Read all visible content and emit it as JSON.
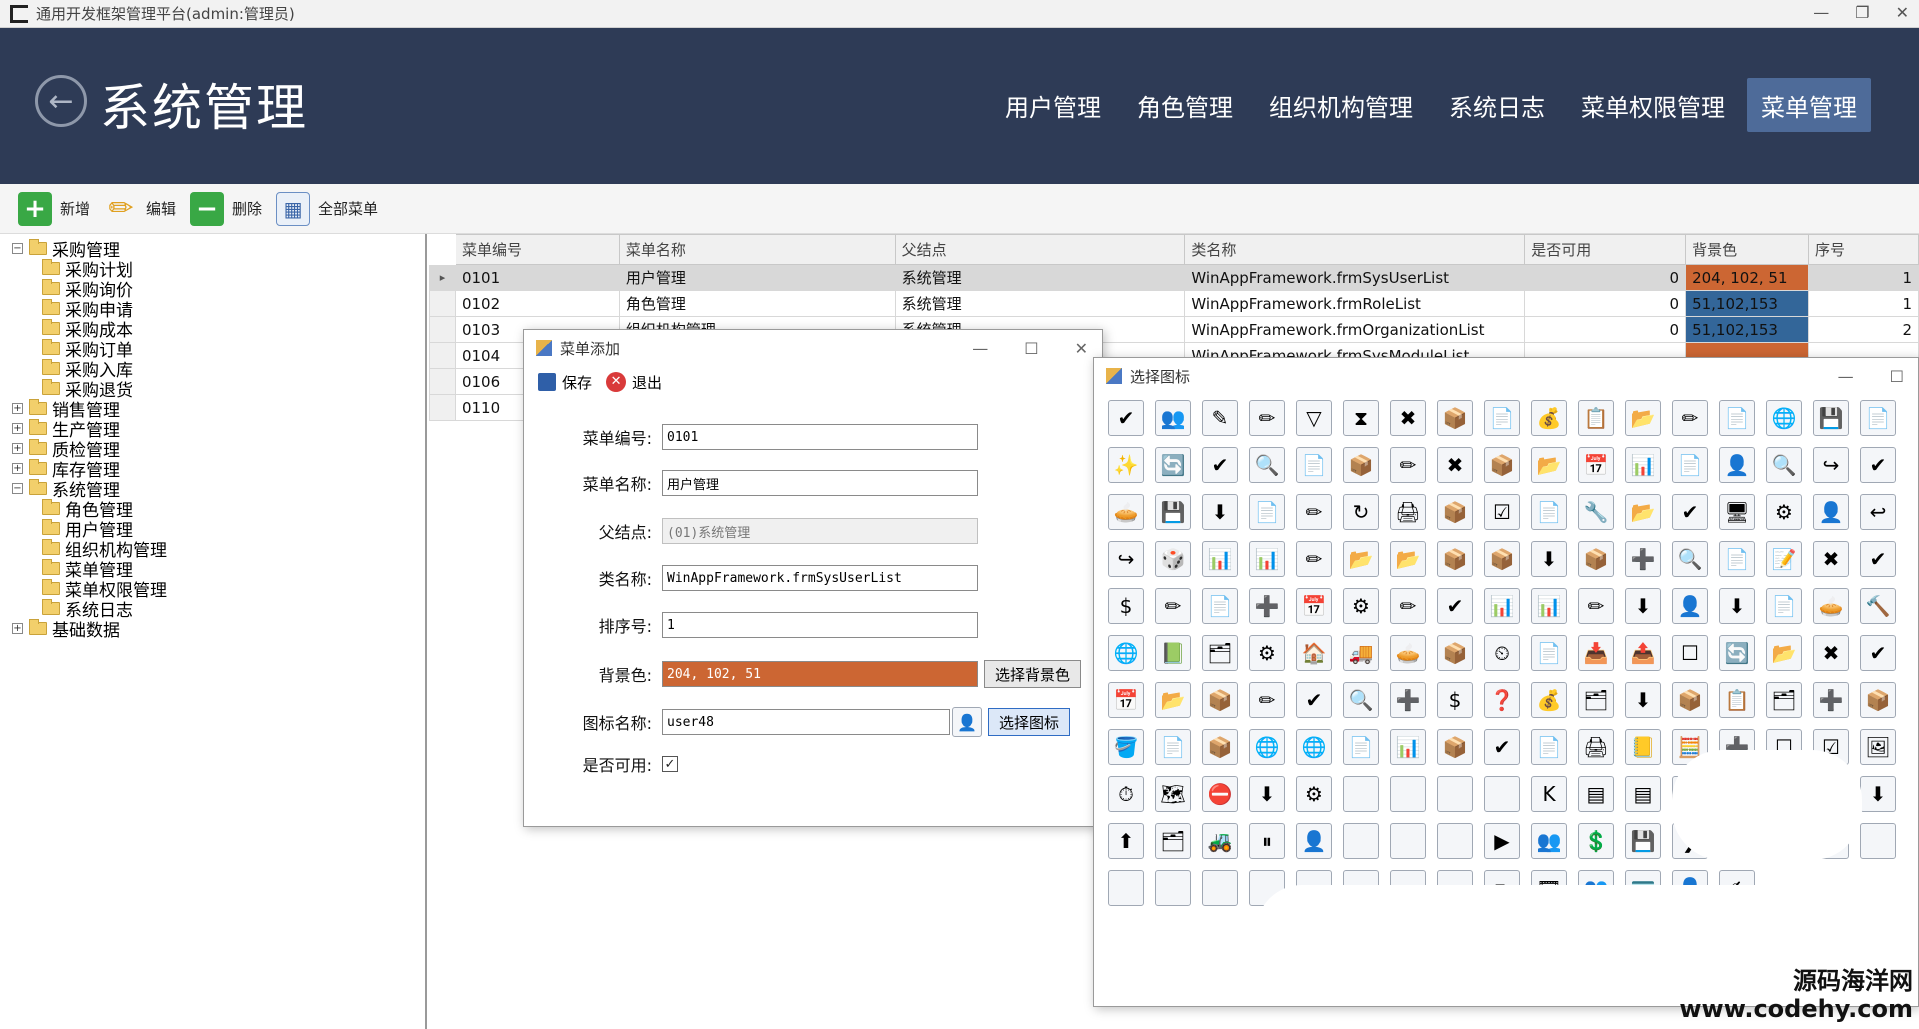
{
  "window": {
    "title": "通用开发框架管理平台(admin:管理员)",
    "minimize": "—",
    "restore": "❐",
    "close": "✕"
  },
  "header": {
    "back_glyph": "←",
    "title": "系统管理",
    "nav": [
      "用户管理",
      "角色管理",
      "组织机构管理",
      "系统日志",
      "菜单权限管理",
      "菜单管理"
    ],
    "active_nav": "菜单管理"
  },
  "toolbar": {
    "add": "新增",
    "edit": "编辑",
    "delete": "删除",
    "all_menu": "全部菜单"
  },
  "tree": {
    "nodes": [
      {
        "label": "采购管理",
        "level": 0,
        "expander": "−"
      },
      {
        "label": "采购计划",
        "level": 1
      },
      {
        "label": "采购询价",
        "level": 1
      },
      {
        "label": "采购申请",
        "level": 1
      },
      {
        "label": "采购成本",
        "level": 1
      },
      {
        "label": "采购订单",
        "level": 1
      },
      {
        "label": "采购入库",
        "level": 1
      },
      {
        "label": "采购退货",
        "level": 1
      },
      {
        "label": "销售管理",
        "level": 0,
        "expander": "+"
      },
      {
        "label": "生产管理",
        "level": 0,
        "expander": "+"
      },
      {
        "label": "质检管理",
        "level": 0,
        "expander": "+"
      },
      {
        "label": "库存管理",
        "level": 0,
        "expander": "+"
      },
      {
        "label": "系统管理",
        "level": 0,
        "expander": "−"
      },
      {
        "label": "角色管理",
        "level": 1
      },
      {
        "label": "用户管理",
        "level": 1
      },
      {
        "label": "组织机构管理",
        "level": 1
      },
      {
        "label": "菜单管理",
        "level": 1
      },
      {
        "label": "菜单权限管理",
        "level": 1
      },
      {
        "label": "系统日志",
        "level": 1
      },
      {
        "label": "基础数据",
        "level": 0,
        "expander": "+"
      }
    ]
  },
  "grid": {
    "columns": [
      "菜单编号",
      "菜单名称",
      "父结点",
      "类名称",
      "是否可用",
      "背景色",
      "序号"
    ],
    "rows": [
      {
        "id": "0101",
        "name": "用户管理",
        "parent": "系统管理",
        "class": "WinAppFramework.frmSysUserList",
        "enabled": "0",
        "color": "204, 102, 51",
        "color_hex": "#cc6633",
        "order": "1",
        "selected": true
      },
      {
        "id": "0102",
        "name": "角色管理",
        "parent": "系统管理",
        "class": "WinAppFramework.frmRoleList",
        "enabled": "0",
        "color": "51,102,153",
        "color_hex": "#336699",
        "order": "1"
      },
      {
        "id": "0103",
        "name": "组织机构管理",
        "parent": "系统管理",
        "class": "WinAppFramework.frmOrganizationList",
        "enabled": "0",
        "color": "51,102,153",
        "color_hex": "#336699",
        "order": "2"
      },
      {
        "id": "0104",
        "name": "",
        "parent": "",
        "class": "WinAppFramework.frmSysModuleList",
        "enabled": "",
        "color": "",
        "color_hex": "#cc6633",
        "order": ""
      },
      {
        "id": "0106",
        "name": "",
        "parent": "",
        "class": "",
        "enabled": "",
        "color": "",
        "color_hex": "",
        "order": ""
      },
      {
        "id": "0110",
        "name": "",
        "parent": "",
        "class": "",
        "enabled": "",
        "color": "",
        "color_hex": "",
        "order": ""
      }
    ]
  },
  "add_dialog": {
    "title": "菜单添加",
    "save": "保存",
    "exit": "退出",
    "fields": {
      "id_label": "菜单编号:",
      "id_value": "0101",
      "name_label": "菜单名称:",
      "name_value": "用户管理",
      "parent_label": "父结点:",
      "parent_value": "(01)系统管理",
      "class_label": "类名称:",
      "class_value": "WinAppFramework.frmSysUserList",
      "order_label": "排序号:",
      "order_value": "1",
      "bg_label": "背景色:",
      "bg_value": "204, 102, 51",
      "bg_button": "选择背景色",
      "icon_label": "图标名称:",
      "icon_value": "user48",
      "icon_button": "选择图标",
      "enabled_label": "是否可用:",
      "enabled_checked": "✓"
    }
  },
  "icon_dialog": {
    "title": "选择图标",
    "icons": [
      "✔",
      "👥",
      "✎",
      "✏",
      "▽",
      "⧗",
      "✖",
      "📦",
      "📄",
      "💰",
      "📋",
      "📂",
      "✏",
      "📄",
      "🌐",
      "💾",
      "📄",
      "✨",
      "🔄",
      "✔",
      "🔍",
      "📄",
      "📦",
      "✏",
      "✖",
      "📦",
      "📂",
      "📅",
      "📊",
      "📄",
      "👤",
      "🔍",
      "↪",
      "✔",
      "🥧",
      "💾",
      "⬇",
      "📄",
      "✏",
      "↻",
      "🖨",
      "📦",
      "☑",
      "📄",
      "🔧",
      "📂",
      "✔",
      "🖥",
      "⚙",
      "👤",
      "↩",
      "↪",
      "🎲",
      "📊",
      "📊",
      "✏",
      "📂",
      "📂",
      "📦",
      "📦",
      "⬇",
      "📦",
      "➕",
      "🔍",
      "📄",
      "📝",
      "✖",
      "✔",
      "$",
      "✏",
      "📄",
      "➕",
      "📅",
      "⚙",
      "✏",
      "✔",
      "📊",
      "📊",
      "✏",
      "⬇",
      "👤",
      "⬇",
      "📄",
      "🥧",
      "🔨",
      "🌐",
      "📗",
      "🗂",
      "⚙",
      "🏠",
      "🚚",
      "🥧",
      "📦",
      "⏲",
      "📄",
      "📥",
      "📤",
      "☐",
      "🔄",
      "📂",
      "✖",
      "✔",
      "📅",
      "📂",
      "📦",
      "✏",
      "✔",
      "🔍",
      "➕",
      "$",
      "❓",
      "💰",
      "🗂",
      "⬇",
      "📦",
      "📋",
      "🗂",
      "➕",
      "📦",
      "🪣",
      "📄",
      "📦",
      "🌐",
      "🌐",
      "📄",
      "📊",
      "📦",
      "✔",
      "📄",
      "🖨",
      "📒",
      "🧮",
      "➕",
      "☐",
      "☑",
      "🖼",
      "⏱",
      "🗺",
      "⛔",
      "⬇",
      "⚙",
      "",
      "",
      "",
      "",
      "K",
      "▤",
      "▤",
      "🔑",
      "🌐",
      "📃",
      "👤",
      "⬇",
      "⬆",
      "🗂",
      "🚜",
      "⏸",
      "👤",
      "",
      "",
      "",
      "▶",
      "👥",
      "💲",
      "💾",
      "❯",
      "",
      "",
      "",
      "",
      "",
      "",
      "",
      "",
      "",
      "",
      "",
      "",
      "✏",
      "🎞",
      "👥",
      "🪪",
      "👤",
      "✍"
    ]
  },
  "watermark": {
    "line1": "源码海洋网",
    "line2": "www.codehy.com"
  }
}
